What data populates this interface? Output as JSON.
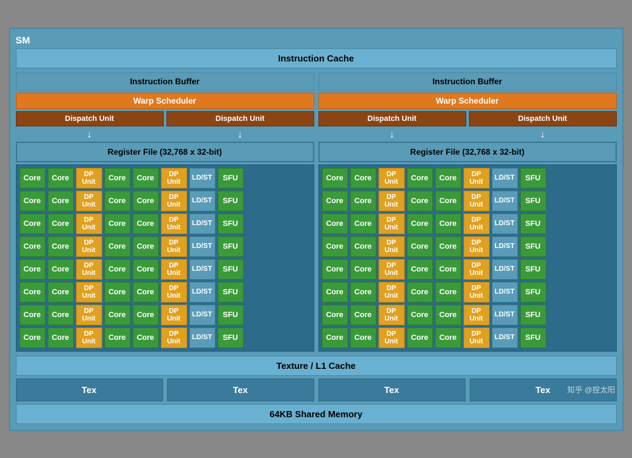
{
  "sm": {
    "label": "SM",
    "instruction_cache": "Instruction Cache",
    "left": {
      "instruction_buffer": "Instruction Buffer",
      "warp_scheduler": "Warp Scheduler",
      "dispatch_unit_1": "Dispatch Unit",
      "dispatch_unit_2": "Dispatch Unit",
      "register_file": "Register File (32,768 x 32-bit)"
    },
    "right": {
      "instruction_buffer": "Instruction Buffer",
      "warp_scheduler": "Warp Scheduler",
      "dispatch_unit_1": "Dispatch Unit",
      "dispatch_unit_2": "Dispatch Unit",
      "register_file": "Register File (32,768 x 32-bit)"
    },
    "core_rows": 8,
    "core_label": "Core",
    "dp_unit_label": "DP\nUnit",
    "ldst_label": "LD/ST",
    "sfu_label": "SFU",
    "texture_cache": "Texture / L1 Cache",
    "tex_label": "Tex",
    "shared_memory": "64KB Shared Memory",
    "watermark": "知乎 @捏太阳"
  }
}
